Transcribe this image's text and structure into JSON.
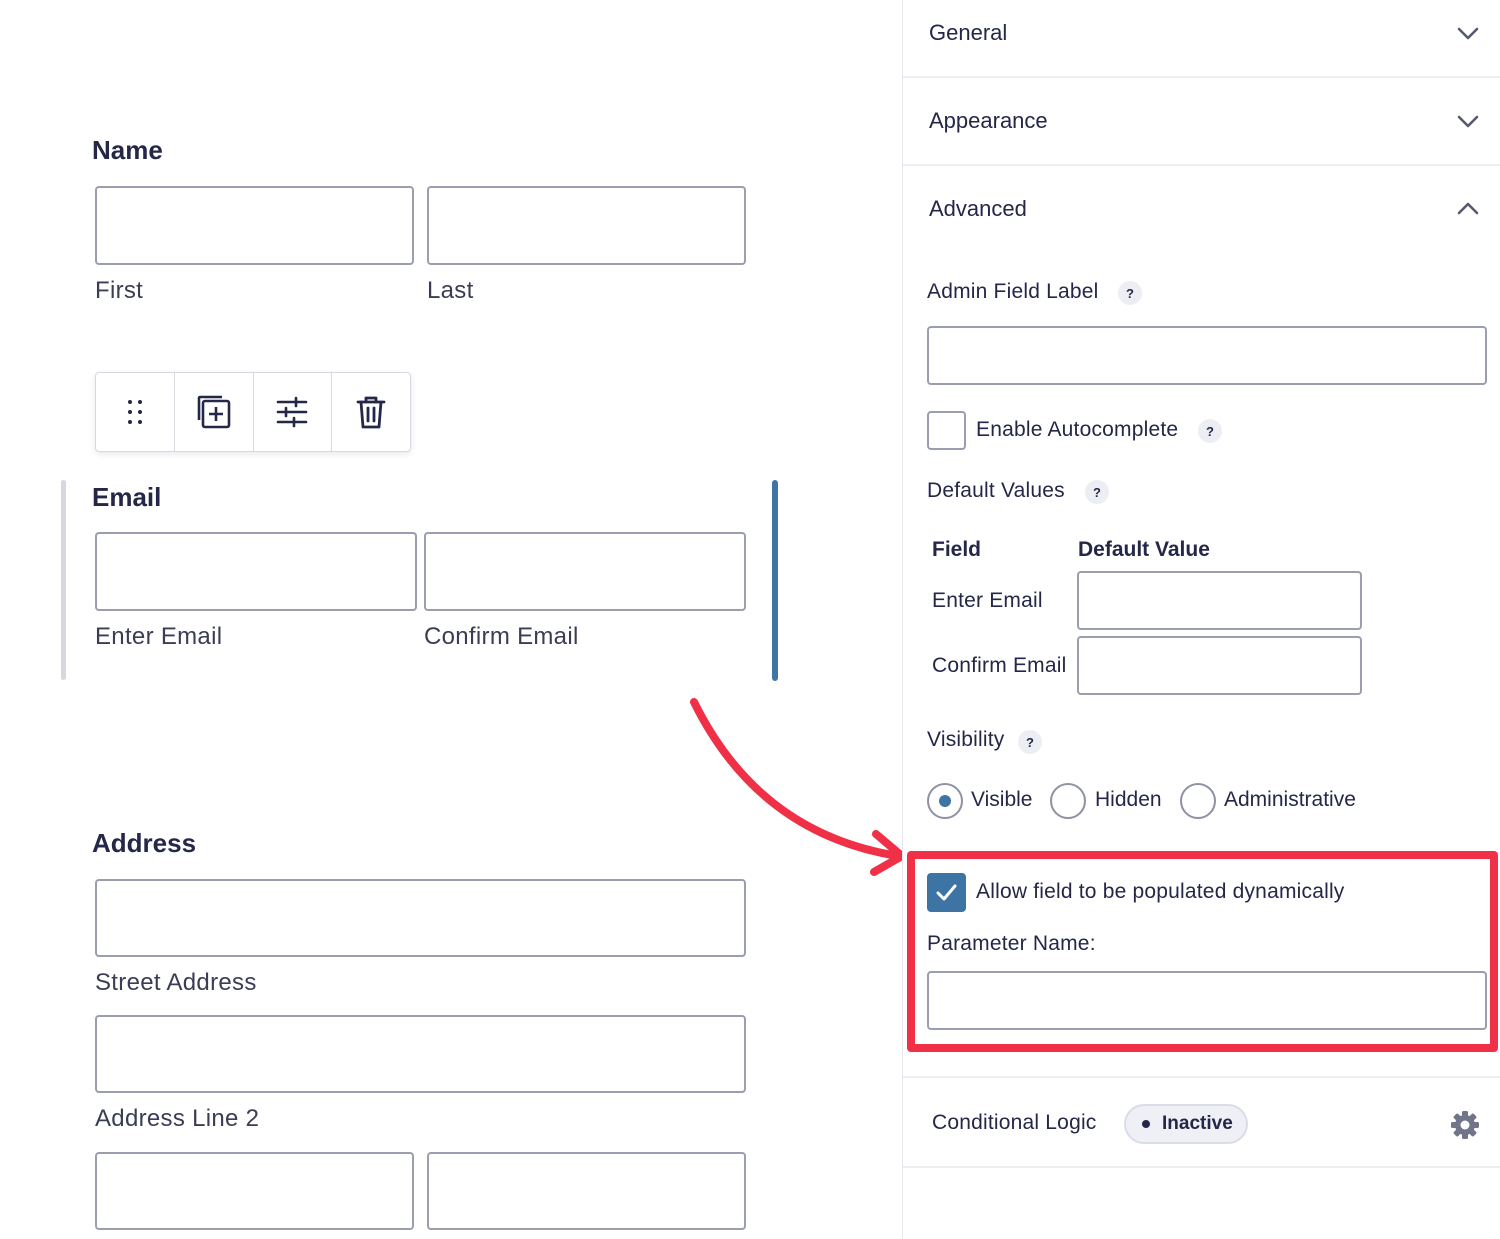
{
  "form": {
    "name": {
      "title": "Name",
      "first": "First",
      "last": "Last"
    },
    "toolbar": {
      "drag": "drag-handle-icon",
      "duplicate": "duplicate-icon",
      "settings": "sliders-icon",
      "delete": "trash-icon"
    },
    "email": {
      "title": "Email",
      "enter": "Enter Email",
      "confirm": "Confirm Email"
    },
    "address": {
      "title": "Address",
      "street": "Street Address",
      "line2": "Address Line 2"
    }
  },
  "panel": {
    "sections": {
      "general": "General",
      "appearance": "Appearance",
      "advanced": "Advanced"
    },
    "admin_field_label": {
      "label": "Admin Field Label",
      "help": "?",
      "value": ""
    },
    "enable_autocomplete": {
      "label": "Enable Autocomplete",
      "help": "?",
      "checked": false
    },
    "default_values": {
      "label": "Default Values",
      "help": "?",
      "col_field": "Field",
      "col_default": "Default Value",
      "rows": [
        {
          "field": "Enter Email",
          "value": ""
        },
        {
          "field": "Confirm Email",
          "value": ""
        }
      ]
    },
    "visibility": {
      "label": "Visibility",
      "help": "?",
      "options": [
        "Visible",
        "Hidden",
        "Administrative"
      ],
      "selected": "Visible"
    },
    "dynamic": {
      "label": "Allow field to be populated dynamically",
      "checked": true,
      "param_label": "Parameter Name:",
      "param_value": ""
    },
    "conditional_logic": {
      "label": "Conditional Logic",
      "status": "Inactive"
    }
  },
  "colors": {
    "accent": "#3e74a4",
    "highlight": "#ef3046",
    "text": "#242748"
  }
}
